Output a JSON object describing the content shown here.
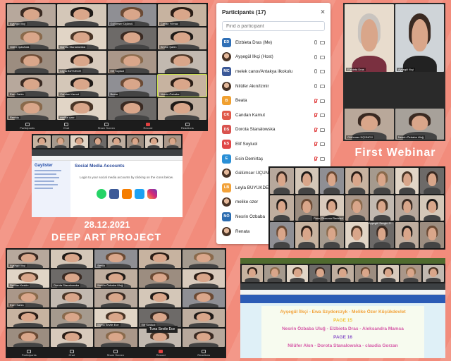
{
  "captions": {
    "date": "28.12.2021",
    "project": "DEEP ART PROJECT",
    "webinar": "First Webinar"
  },
  "colors": {
    "background": "#f28c7c",
    "accent_green": "#c8e04a"
  },
  "zoom_controls": [
    {
      "label": "Participants",
      "icon": "participants-icon"
    },
    {
      "label": "Chat",
      "icon": "chat-icon"
    },
    {
      "label": "Share Screen",
      "icon": "share-screen-icon"
    },
    {
      "label": "Record",
      "icon": "record-icon"
    },
    {
      "label": "Reactions",
      "icon": "reactions-icon"
    }
  ],
  "grid_top_left": {
    "tiles": [
      "Ayşegül İlkçi",
      "",
      "Gülümser Üçüncü",
      "Canan Yılmaz",
      "Gülbe Işık/Anta",
      "Dorota Stanalowska",
      "",
      "Emine Şahin",
      "",
      "Leyla BÜYÜKDE",
      "Elif Soyluol",
      "",
      "Eser Sahin",
      "Candan Kamut",
      "Beata",
      "Nesrin Özbaba",
      "Renata",
      "melike ozer",
      "",
      ""
    ]
  },
  "participants": {
    "title": "Participants (17)",
    "search_placeholder": "Find a participant",
    "items": [
      {
        "initials": "ED",
        "name": "Elzbieta Dras (Me)",
        "color": "#2f6fb6",
        "photo": false,
        "mic_muted": false,
        "cam_muted": false
      },
      {
        "initials": "",
        "name": "Ayşegül İlkçi (Host)",
        "color": "",
        "photo": true,
        "mic_muted": false,
        "cam_muted": false
      },
      {
        "initials": "MC",
        "name": "melek canoı/Antakya ilkokulu",
        "color": "#3b5998",
        "photo": false,
        "mic_muted": false,
        "cam_muted": false
      },
      {
        "initials": "",
        "name": "Nilüfer Akın/İzmir",
        "color": "",
        "photo": true,
        "mic_muted": false,
        "cam_muted": false
      },
      {
        "initials": "B",
        "name": "Beata",
        "color": "#f0a030",
        "photo": false,
        "mic_muted": true,
        "cam_muted": false
      },
      {
        "initials": "CK",
        "name": "Candan Kamut",
        "color": "#e05a4a",
        "photo": false,
        "mic_muted": true,
        "cam_muted": false
      },
      {
        "initials": "DS",
        "name": "Dorota Stanalowska",
        "color": "#d9534f",
        "photo": false,
        "mic_muted": true,
        "cam_muted": false
      },
      {
        "initials": "ES",
        "name": "Elif Soyluol",
        "color": "#e04848",
        "photo": false,
        "mic_muted": true,
        "cam_muted": false
      },
      {
        "initials": "E",
        "name": "Esin Demirtaş",
        "color": "#2a8fd6",
        "photo": false,
        "mic_muted": true,
        "cam_muted": false
      },
      {
        "initials": "",
        "name": "Gülümser ÜÇÜNCÜ",
        "color": "",
        "photo": true,
        "mic_muted": true,
        "cam_muted": false
      },
      {
        "initials": "LB",
        "name": "Leyla BÜYÜKDE",
        "color": "#f2a23a",
        "photo": false,
        "mic_muted": true,
        "cam_muted": false
      },
      {
        "initials": "",
        "name": "melike ozer",
        "color": "",
        "photo": true,
        "mic_muted": true,
        "cam_muted": false
      },
      {
        "initials": "NÖ",
        "name": "Nesrin Özbaba",
        "color": "#2b6cb0",
        "photo": false,
        "mic_muted": true,
        "cam_muted": false
      },
      {
        "initials": "",
        "name": "Renata",
        "color": "",
        "photo": true,
        "mic_muted": true,
        "cam_muted": false
      }
    ]
  },
  "webinar_window": {
    "tiles": [
      "Elzbieta Dras",
      "Ayşegül İlkçi",
      "Gülümser ÜÇÜNCÜ",
      "Nesrin Özbaba Uluğ"
    ]
  },
  "social_browser": {
    "sidebar_title": "Gaylister",
    "page_title": "Social Media Accounts",
    "login_text": "Login to your social media accounts by clicking on the icons below."
  },
  "grid_bottom_left": {
    "tiles": [
      "Ayşegül İlkçi",
      "",
      "Beata",
      "",
      "",
      "Sevcan Keskin",
      "Dorota Stanalowska",
      "Nesrin Özbaba Uluğ",
      "",
      "",
      "Eser Sahin",
      "",
      "",
      "",
      "",
      "",
      "",
      "Esma Sevile Ece",
      "Elif Soyluol",
      "",
      "",
      "",
      "",
      "",
      ""
    ],
    "highlight_tile": "Tuna Sevile Ece"
  },
  "grid_mid_right": {
    "tiles": [
      "",
      "",
      "",
      "",
      "",
      "",
      "",
      "",
      "",
      "",
      "",
      "",
      "",
      "",
      "",
      "",
      "",
      "",
      "",
      "",
      ""
    ],
    "shared_label": "Ayşegül Sevgin G...",
    "notice": "Pano Oturumu Renkleri"
  },
  "doc_browser": {
    "lines": [
      {
        "text": "Ayşegül İlkçi - Ewa Szydorczyk - Melike Özer Küçükdevlet",
        "color": "#f2a23a"
      },
      {
        "text": "PAGE 15",
        "color": "#f2c53a"
      },
      {
        "text": "Nesrin Özbaba Uluğ - Elżbieta Dras - Aleksandra Mamsa",
        "color": "#d65aa8"
      },
      {
        "text": "PAGE 16",
        "color": "#8c59c9"
      },
      {
        "text": "Nilüfer Akın - Dorota Stanalowska - claudia Gorzan",
        "color": "#d65aa8"
      }
    ]
  }
}
